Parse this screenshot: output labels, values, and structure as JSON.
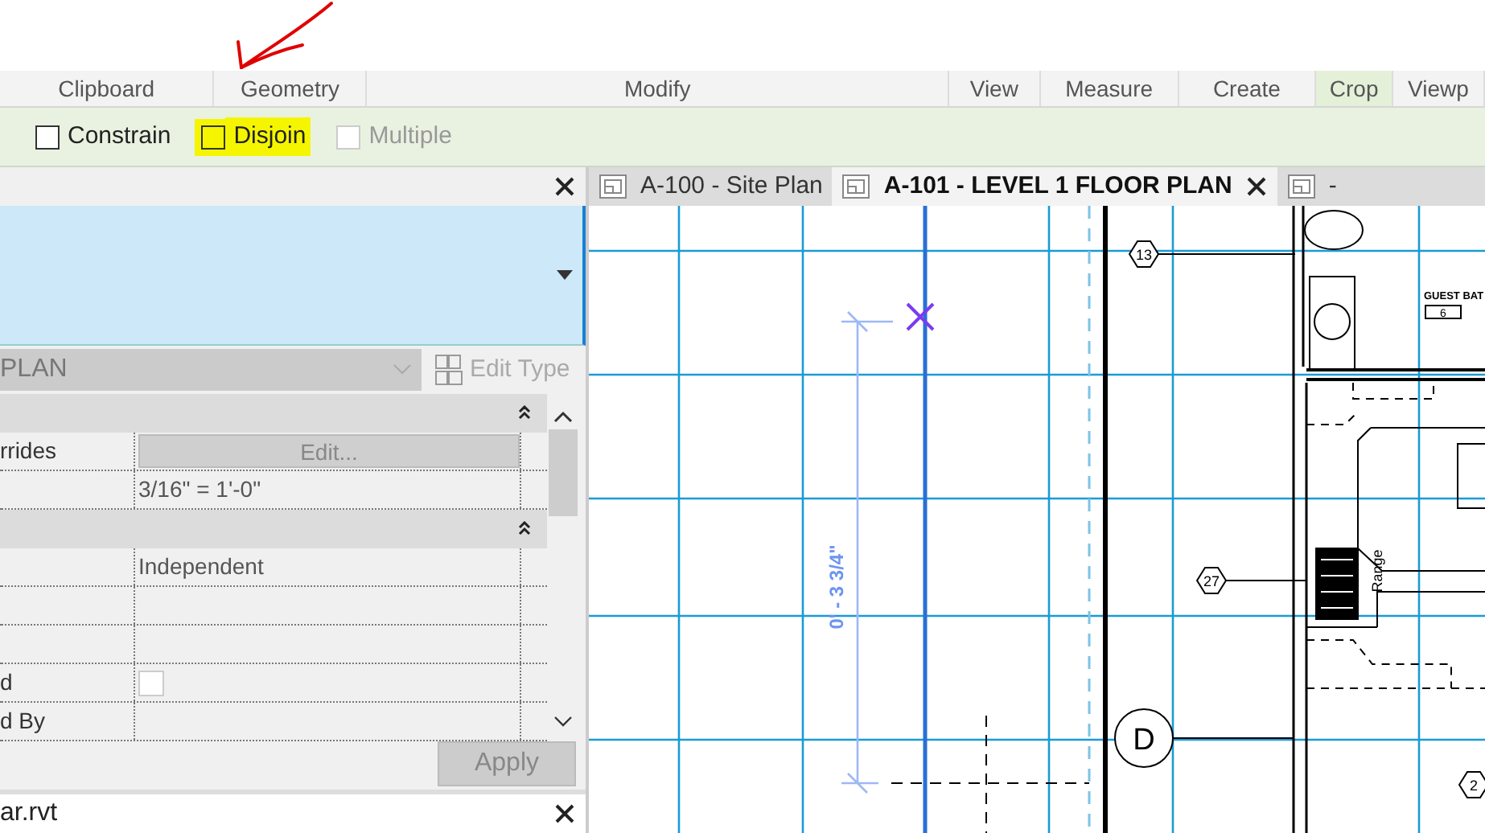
{
  "ribbon_panels": [
    {
      "label": "Clipboard",
      "contextual": false
    },
    {
      "label": "Geometry",
      "contextual": false
    },
    {
      "label": "Modify",
      "contextual": false
    },
    {
      "label": "View",
      "contextual": false
    },
    {
      "label": "Measure",
      "contextual": false
    },
    {
      "label": "Create",
      "contextual": false
    },
    {
      "label": "Crop",
      "contextual": true
    },
    {
      "label": "Viewp",
      "contextual": false
    }
  ],
  "options_bar": [
    {
      "label": "Constrain",
      "checked": false,
      "disabled": false,
      "highlighted": false
    },
    {
      "label": "Disjoin",
      "checked": false,
      "disabled": false,
      "highlighted": true
    },
    {
      "label": "Multiple",
      "checked": false,
      "disabled": true,
      "highlighted": false
    }
  ],
  "properties": {
    "view_dropdown": "PLAN",
    "edit_type": "Edit Type",
    "groups": [
      {
        "expanded": true,
        "rows": [
          {
            "kind": "button",
            "name": "rrides",
            "value": "Edit..."
          },
          {
            "kind": "text",
            "value": "3/16\" = 1'-0\""
          }
        ]
      },
      {
        "expanded": true,
        "rows": [
          {
            "kind": "text",
            "value": "Independent"
          },
          {
            "kind": "text"
          },
          {
            "kind": "text"
          },
          {
            "kind": "checkbox",
            "name": "d",
            "checked": false
          },
          {
            "kind": "text",
            "name": "d By"
          }
        ]
      }
    ],
    "apply": "Apply"
  },
  "project_browser": {
    "title": "ar.rvt"
  },
  "view_tabs": [
    {
      "label": "A-100 - Site Plan",
      "selected": false
    },
    {
      "label": "A-101 - LEVEL 1 FLOOR PLAN",
      "selected": true
    },
    {
      "label": "-",
      "selected": false
    }
  ],
  "drawing": {
    "tags": [
      "13",
      "27",
      "2"
    ],
    "grid_bubble": "D",
    "room_name": "GUEST BAT",
    "room_number": "6",
    "dimension": "0' - 3 3/4\"",
    "fixture_label": "Range"
  }
}
